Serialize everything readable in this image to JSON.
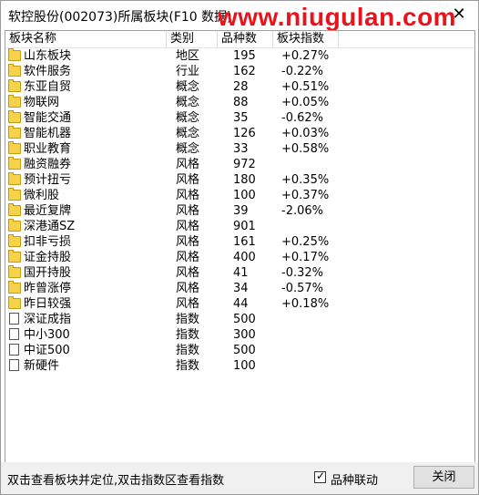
{
  "window": {
    "title": "软控股份(002073)所属板块(F10 数据)",
    "watermark": "www.niugulan.com",
    "close_glyph": "✕"
  },
  "columns": [
    "板块名称",
    "类别",
    "品种数",
    "板块指数"
  ],
  "rows": [
    {
      "name": "山东板块",
      "type": "地区",
      "count": "195",
      "index": "+0.27%",
      "icon": "folder-icon"
    },
    {
      "name": "软件服务",
      "type": "行业",
      "count": "162",
      "index": "-0.22%",
      "icon": "folder-icon"
    },
    {
      "name": "东亚自贸",
      "type": "概念",
      "count": "28",
      "index": "+0.51%",
      "icon": "folder-icon"
    },
    {
      "name": "物联网",
      "type": "概念",
      "count": "88",
      "index": "+0.05%",
      "icon": "folder-icon"
    },
    {
      "name": "智能交通",
      "type": "概念",
      "count": "35",
      "index": "-0.62%",
      "icon": "folder-icon"
    },
    {
      "name": "智能机器",
      "type": "概念",
      "count": "126",
      "index": "+0.03%",
      "icon": "folder-icon"
    },
    {
      "name": "职业教育",
      "type": "概念",
      "count": "33",
      "index": "+0.58%",
      "icon": "folder-icon"
    },
    {
      "name": "融资融券",
      "type": "风格",
      "count": "972",
      "index": "",
      "icon": "folder-icon"
    },
    {
      "name": "预计扭亏",
      "type": "风格",
      "count": "180",
      "index": "+0.35%",
      "icon": "folder-icon"
    },
    {
      "name": "微利股",
      "type": "风格",
      "count": "100",
      "index": "+0.37%",
      "icon": "folder-icon"
    },
    {
      "name": "最近复牌",
      "type": "风格",
      "count": "39",
      "index": "-2.06%",
      "icon": "folder-icon"
    },
    {
      "name": "深港通SZ",
      "type": "风格",
      "count": "901",
      "index": "",
      "icon": "folder-icon"
    },
    {
      "name": "扣非亏损",
      "type": "风格",
      "count": "161",
      "index": "+0.25%",
      "icon": "folder-icon"
    },
    {
      "name": "证金持股",
      "type": "风格",
      "count": "400",
      "index": "+0.17%",
      "icon": "folder-icon"
    },
    {
      "name": "国开持股",
      "type": "风格",
      "count": "41",
      "index": "-0.32%",
      "icon": "folder-icon"
    },
    {
      "name": "昨曾涨停",
      "type": "风格",
      "count": "34",
      "index": "-0.57%",
      "icon": "folder-icon"
    },
    {
      "name": "昨日较强",
      "type": "风格",
      "count": "44",
      "index": "+0.18%",
      "icon": "folder-icon"
    },
    {
      "name": "深证成指",
      "type": "指数",
      "count": "500",
      "index": "",
      "icon": "document-icon"
    },
    {
      "name": "中小300",
      "type": "指数",
      "count": "300",
      "index": "",
      "icon": "document-icon"
    },
    {
      "name": "中证500",
      "type": "指数",
      "count": "500",
      "index": "",
      "icon": "document-icon"
    },
    {
      "name": "新硬件",
      "type": "指数",
      "count": "100",
      "index": "",
      "icon": "document-icon"
    }
  ],
  "status": {
    "hint": "双击查看板块并定位,双击指数区查看指数",
    "checkbox_label": "品种联动",
    "checkbox_checked": true,
    "check_glyph": "✓",
    "close_button": "关闭"
  }
}
